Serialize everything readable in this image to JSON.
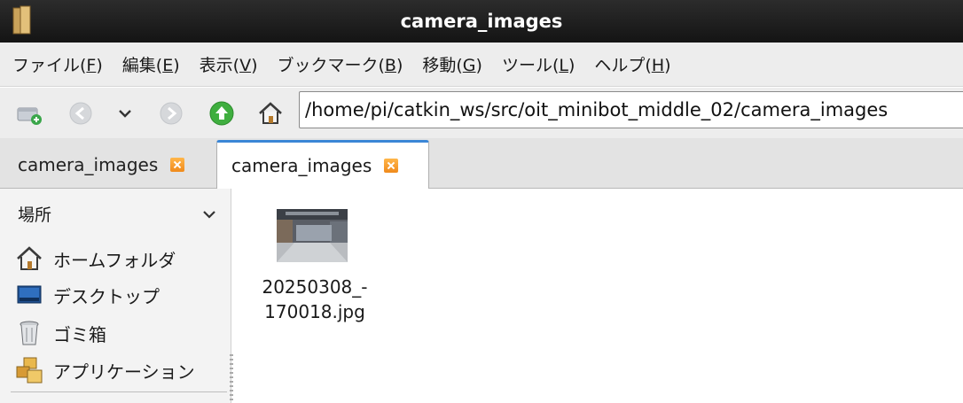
{
  "window": {
    "title": "camera_images"
  },
  "menu": [
    {
      "label": "ファイル(",
      "mnemonic": "F",
      "suffix": ")"
    },
    {
      "label": "編集(",
      "mnemonic": "E",
      "suffix": ")"
    },
    {
      "label": "表示(",
      "mnemonic": "V",
      "suffix": ")"
    },
    {
      "label": "ブックマーク(",
      "mnemonic": "B",
      "suffix": ")"
    },
    {
      "label": "移動(",
      "mnemonic": "G",
      "suffix": ")"
    },
    {
      "label": "ツール(",
      "mnemonic": "L",
      "suffix": ")"
    },
    {
      "label": "ヘルプ(",
      "mnemonic": "H",
      "suffix": ")"
    }
  ],
  "toolbar": {
    "path": "/home/pi/catkin_ws/src/oit_minibot_middle_02/camera_images",
    "icons": [
      "new-tab-icon",
      "back-icon",
      "history-dropdown-icon",
      "forward-icon",
      "up-icon",
      "home-icon"
    ]
  },
  "tabs": [
    {
      "label": "camera_images",
      "active": false
    },
    {
      "label": "camera_images",
      "active": true
    }
  ],
  "sidebar": {
    "header": "場所",
    "items": [
      {
        "label": "ホームフォルダ",
        "icon": "home-icon"
      },
      {
        "label": "デスクトップ",
        "icon": "desktop-icon"
      },
      {
        "label": "ゴミ箱",
        "icon": "trash-icon"
      },
      {
        "label": "アプリケーション",
        "icon": "applications-icon"
      }
    ]
  },
  "files": [
    {
      "name_line1": "20250308_-",
      "name_line2": "170018.jpg",
      "type": "image"
    }
  ],
  "colors": {
    "titlebar": "#1c1c1c",
    "tab_accent": "#3b86d6",
    "up_button": "#3fae3f",
    "tab_close": "#f39a2a"
  }
}
